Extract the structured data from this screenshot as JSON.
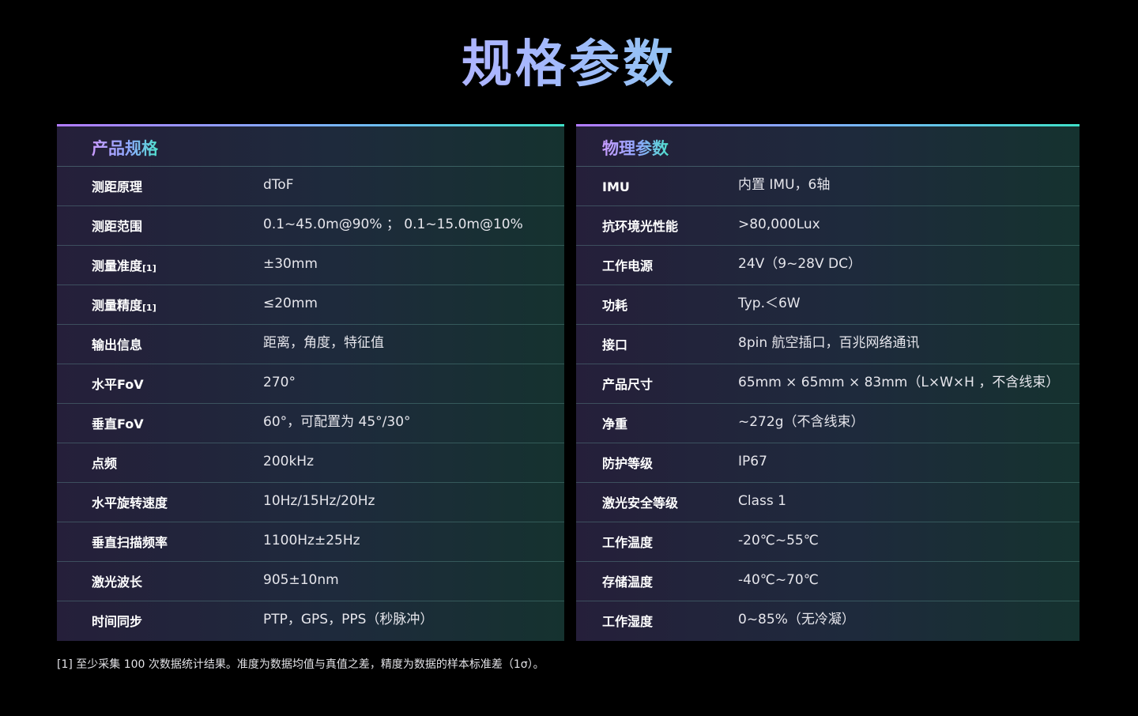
{
  "page_title": "规格参数",
  "left_panel": {
    "title": "产品规格",
    "rows": [
      {
        "label": "测距原理",
        "note": "",
        "value": "dToF"
      },
      {
        "label": "测距范围",
        "note": "",
        "value": "0.1~45.0m@90% ； 0.1~15.0m@10%"
      },
      {
        "label": "测量准度",
        "note": "[1]",
        "value": "±30mm"
      },
      {
        "label": "测量精度",
        "note": "[1]",
        "value": "≤20mm"
      },
      {
        "label": "输出信息",
        "note": "",
        "value": "距离，角度，特征值"
      },
      {
        "label": "水平FoV",
        "note": "",
        "value": "270°"
      },
      {
        "label": "垂直FoV",
        "note": "",
        "value": "60°，可配置为 45°/30°"
      },
      {
        "label": "点频",
        "note": "",
        "value": "200kHz"
      },
      {
        "label": "水平旋转速度",
        "note": "",
        "value": "10Hz/15Hz/20Hz"
      },
      {
        "label": "垂直扫描频率",
        "note": "",
        "value": "1100Hz±25Hz"
      },
      {
        "label": "激光波长",
        "note": "",
        "value": "905±10nm"
      },
      {
        "label": "时间同步",
        "note": "",
        "value": "PTP，GPS，PPS（秒脉冲）"
      }
    ]
  },
  "right_panel": {
    "title": "物理参数",
    "rows": [
      {
        "label": "IMU",
        "value": "内置 IMU，6轴"
      },
      {
        "label": "抗环境光性能",
        "value": ">80,000Lux"
      },
      {
        "label": "工作电源",
        "value": "24V（9~28V DC）"
      },
      {
        "label": "功耗",
        "value": "Typ.＜6W"
      },
      {
        "label": "接口",
        "value": "8pin 航空插口，百兆网络通讯"
      },
      {
        "label": "产品尺寸",
        "value": "65mm × 65mm × 83mm（L×W×H ，不含线束）"
      },
      {
        "label": "净重",
        "value": "~272g（不含线束）"
      },
      {
        "label": "防护等级",
        "value": "IP67"
      },
      {
        "label": "激光安全等级",
        "value": "Class 1"
      },
      {
        "label": "工作温度",
        "value": "-20℃~55℃"
      },
      {
        "label": "存储温度",
        "value": "-40℃~70℃"
      },
      {
        "label": "工作湿度",
        "value": "0~85%（无冷凝）"
      }
    ]
  },
  "footnote": "[1] 至少采集 100 次数据统计结果。准度为数据均值与真值之差，精度为数据的样本标准差（1σ）。",
  "colors": {
    "background": "#000000",
    "title_gradient_start": "#d8a6ff",
    "title_gradient_end": "#4fe6d0",
    "panel_left_tint": "#251f3a",
    "panel_right_tint": "#15322f"
  }
}
